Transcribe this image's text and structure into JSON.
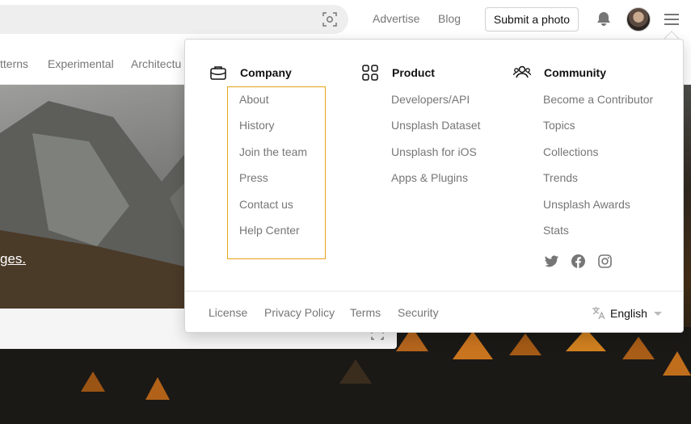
{
  "header": {
    "nav": [
      "Advertise",
      "Blog"
    ],
    "submit_label": "Submit a photo"
  },
  "categories": [
    "tterns",
    "Experimental",
    "Architectu"
  ],
  "hero": {
    "text_fragment": "ges."
  },
  "dropdown": {
    "columns": [
      {
        "title": "Company",
        "icon": "briefcase-icon",
        "items": [
          "About",
          "History",
          "Join the team",
          "Press",
          "Contact us",
          "Help Center"
        ]
      },
      {
        "title": "Product",
        "icon": "grid-icon",
        "items": [
          "Developers/API",
          "Unsplash Dataset",
          "Unsplash for iOS",
          "Apps & Plugins"
        ]
      },
      {
        "title": "Community",
        "icon": "people-icon",
        "items": [
          "Become a Contributor",
          "Topics",
          "Collections",
          "Trends",
          "Unsplash Awards",
          "Stats"
        ]
      }
    ],
    "social_icons": [
      "twitter-icon",
      "facebook-icon",
      "instagram-icon"
    ],
    "footer_links": [
      "License",
      "Privacy Policy",
      "Terms",
      "Security"
    ],
    "language": "English",
    "highlight_color": "#e8a317"
  }
}
